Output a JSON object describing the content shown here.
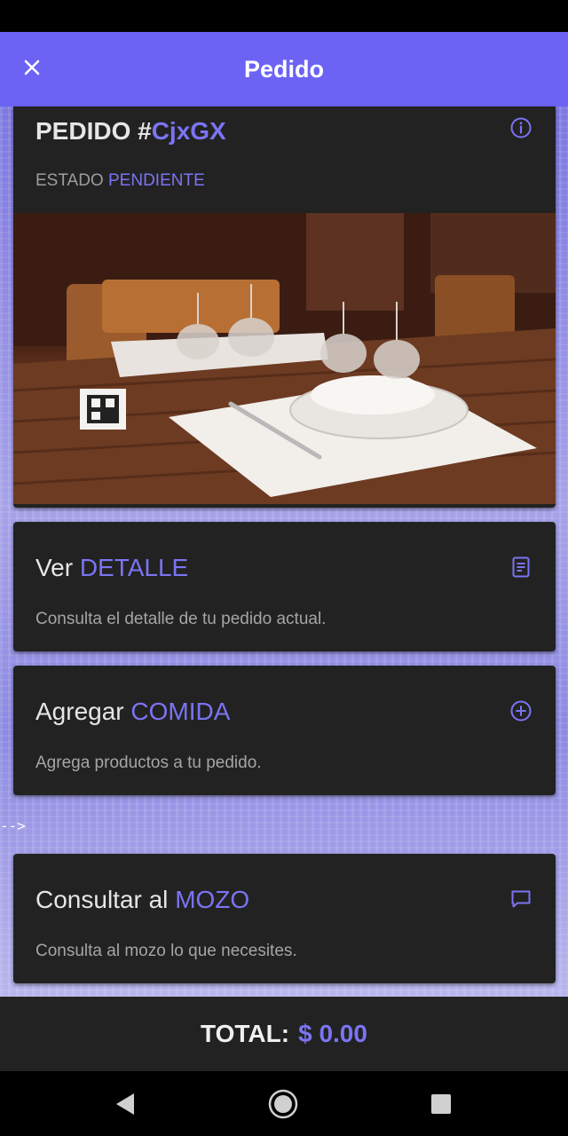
{
  "app_bar": {
    "title": "Pedido"
  },
  "order": {
    "title_prefix": "PEDIDO #",
    "code": "CjxGX",
    "status_label": "ESTADO",
    "status_value": "PENDIENTE"
  },
  "cards": [
    {
      "title": "Ver",
      "accent": "DETALLE",
      "desc": "Consulta el detalle de tu pedido actual.",
      "icon": "document-icon"
    },
    {
      "title": "Agregar",
      "accent": "COMIDA",
      "desc": "Agrega productos a tu pedido.",
      "icon": "add-circle-icon"
    },
    {
      "title": "Consultar al",
      "accent": "MOZO",
      "desc": "Consulta al mozo lo que necesites.",
      "icon": "chat-icon"
    }
  ],
  "stray_text": "-->",
  "total": {
    "label": "TOTAL:",
    "value": "$ 0.00"
  },
  "colors": {
    "accent": "#6c63f5",
    "card": "#222222",
    "text": "#e6e6e6"
  }
}
